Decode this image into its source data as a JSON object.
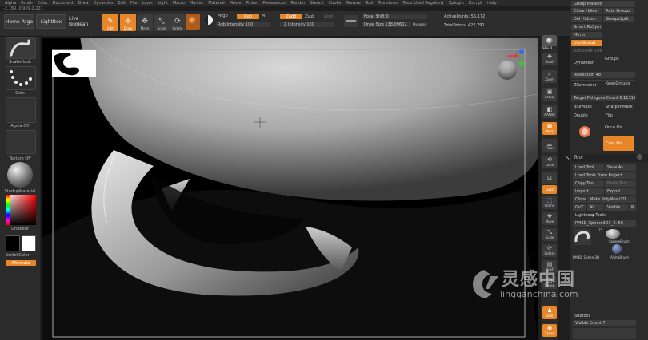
{
  "menu": [
    "Alpha",
    "Brush",
    "Color",
    "Document",
    "Draw",
    "Dynamics",
    "Edit",
    "File",
    "Layer",
    "Light",
    "Macro",
    "Marker",
    "Material",
    "Movie",
    "Picker",
    "Preferences",
    "Render",
    "Stencil",
    "Stroke",
    "Texture",
    "Tool",
    "Transform",
    "Tools Used Regularly",
    "Zplugin",
    "Zscript",
    "Help"
  ],
  "coords": "-2.189,-0.909,0.221",
  "nav": {
    "home": "Home Page",
    "lightbox": "LightBox",
    "boolean": "Live Boolean"
  },
  "tools": {
    "edit": "Edit",
    "draw": "Draw",
    "move": "Move",
    "scale": "Scale",
    "rotate": "Rotate"
  },
  "params": {
    "mrgb": "Mrgb",
    "rgb": "Rgb",
    "m": "M",
    "zadd": "Zadd",
    "zsub": "Zsub",
    "zcut": "Zcut",
    "rgb_intensity": "Rgb Intensity 100",
    "z_intensity": "Z Intensity 100",
    "focal_shift": "Focal Shift 0",
    "draw_size": "Draw Size 138.09602",
    "dynamic": "Dynamic",
    "active_points": "ActivePoints: 55,172",
    "total_points": "TotalPoints: 422,791"
  },
  "left": {
    "brush": "SnakeHook",
    "stroke": "Dots",
    "alpha": "Alpha Off",
    "texture": "Texture Off",
    "material": "StartupMaterial",
    "gradient": "Gradient",
    "switch": "SwitchColor",
    "alternate": "Alternate"
  },
  "dock": {
    "spix": "SPix 3",
    "bpr": "BPR",
    "scroll": "Scroll",
    "zoom": "Zoom",
    "actual": "Actual",
    "aahalf": "AAHalf",
    "persp": "Persp",
    "floor": "Floor",
    "local": "Local",
    "gxyz": "Gxyz",
    "frame": "Frame",
    "move": "Move",
    "scale": "Scale",
    "rotate": "Rotate",
    "polyf": "PolyF",
    "transp": "Transp",
    "solo": "Solo",
    "xpose": "Xpose"
  },
  "panel": {
    "group_masked": "Group Masked",
    "close_holes": "Close Holes",
    "auto_groups": "Auto Groups",
    "del_hidden": "Del Hidden",
    "groups_split": "GroupsSplit",
    "smart_resym": "Smart ReSym",
    "mirror": "Mirror",
    "use_global": "Use Global",
    "subdivide_size": "Subdivide Size",
    "groups": "Groups",
    "dynamesh": "DynaMesh",
    "resolution": "Resolution 48",
    "zremesher": "ZRemesher",
    "keep_groups": "KeepGroups",
    "target_polys": "Target Polygons Count 0.11319",
    "blur_mask": "BlurMask",
    "sharpen_mask": "SharpenMask",
    "double": "Double",
    "flip": "Flip",
    "once_on": "Once On",
    "cont_on": "Cont On",
    "tool_title": "Tool",
    "load_tool": "Load Tool",
    "save_as": "Save As",
    "load_tools_project": "Load Tools From Project",
    "copy_tool": "Copy Tool",
    "paste_tool": "Paste Tool",
    "import": "Import",
    "export": "Export",
    "clone": "Clone",
    "make_polymesh": "Make PolyMesh3D",
    "goz": "GoZ",
    "all": "All",
    "visible": "Visible",
    "r": "R",
    "lightbox_tools": "Lightbox▶Tools",
    "current_tool": "PM3D_Sphere3D1_4. 50",
    "sphere_brush": "SphereBrush",
    "pm3d_sphere": "PM3D_Sphere3D",
    "alpha_brush": "AlphaBrush",
    "subtool": "Subtool",
    "visible_count": "Visible Count 7"
  },
  "watermark": {
    "cn": "灵感中国",
    "url": "lingganchina.com"
  }
}
